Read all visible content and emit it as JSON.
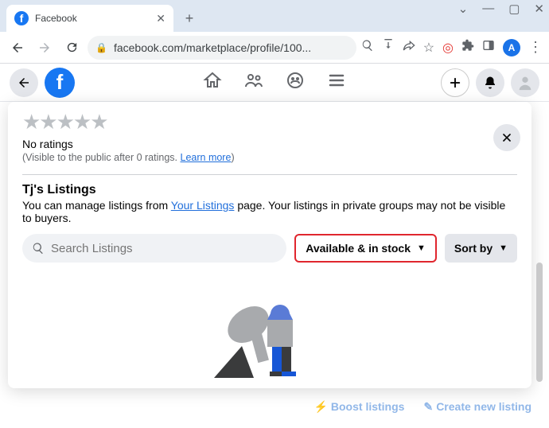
{
  "browser": {
    "tab_title": "Facebook",
    "url": "facebook.com/marketplace/profile/100...",
    "profile_initial": "A"
  },
  "fb": {
    "ratings": {
      "no_ratings": "No ratings",
      "visible_prefix": "(Visible to the public after 0 ratings. ",
      "learn_more": "Learn more",
      "visible_suffix": ")"
    },
    "listings": {
      "title": "Tj's Listings",
      "desc_prefix": "You can manage listings from ",
      "desc_link": "Your Listings",
      "desc_suffix": " page. Your listings in private groups may not be visible to buyers."
    },
    "controls": {
      "search_placeholder": "Search Listings",
      "filter_label": "Available & in stock",
      "sort_label": "Sort by"
    },
    "bottom": {
      "boost": "Boost listings",
      "create": "Create new listing"
    }
  }
}
